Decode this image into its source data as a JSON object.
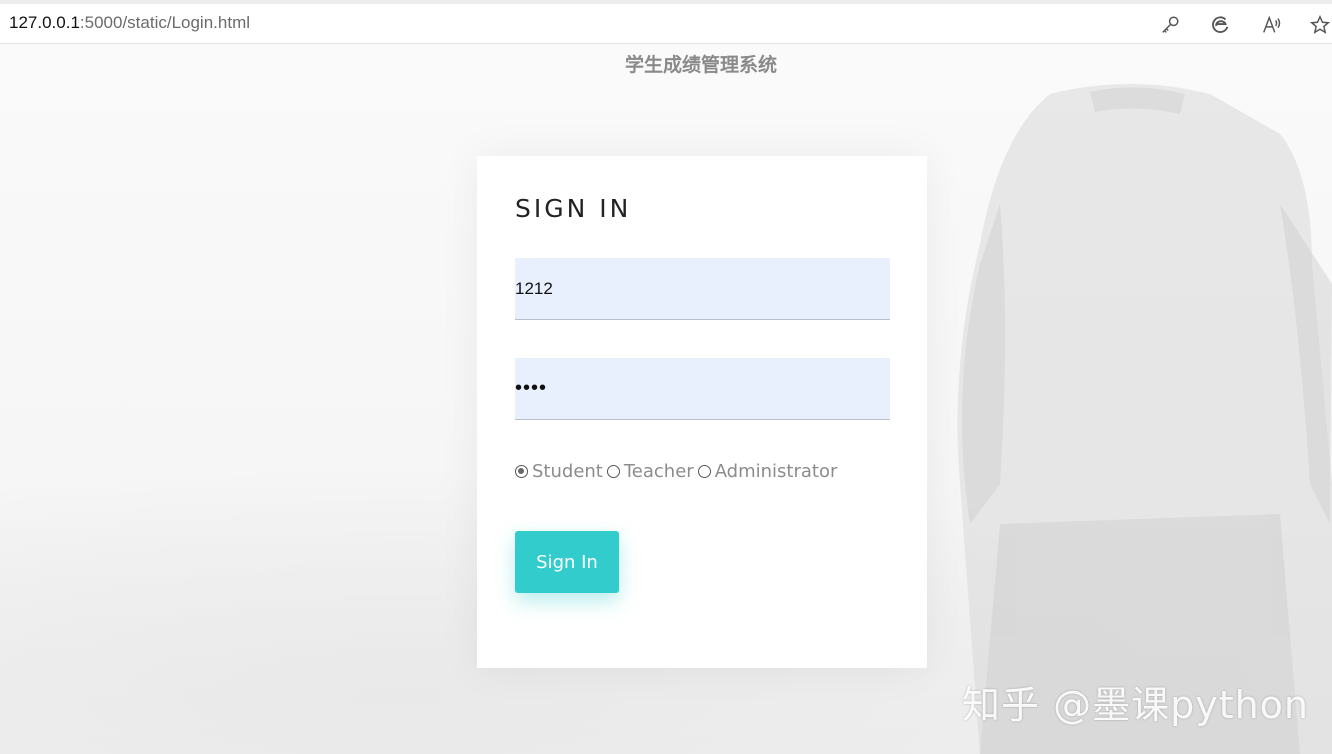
{
  "browser": {
    "url_host": "127.0.0.1",
    "url_path": ":5000/static/Login.html",
    "icons": [
      "key-icon",
      "edge-collections-icon",
      "read-aloud-icon",
      "favorite-star-icon"
    ]
  },
  "page": {
    "site_title": "学生成绩管理系统"
  },
  "login": {
    "title": "SIGN IN",
    "username_value": "1212",
    "password_value": "••••",
    "roles": [
      {
        "label": "Student",
        "checked": true
      },
      {
        "label": "Teacher",
        "checked": false
      },
      {
        "label": "Administrator",
        "checked": false
      }
    ],
    "submit_label": "Sign In",
    "accent_color": "#33cccc",
    "field_fill_color": "#e8f0fe"
  },
  "watermark": "知乎 @墨课python"
}
